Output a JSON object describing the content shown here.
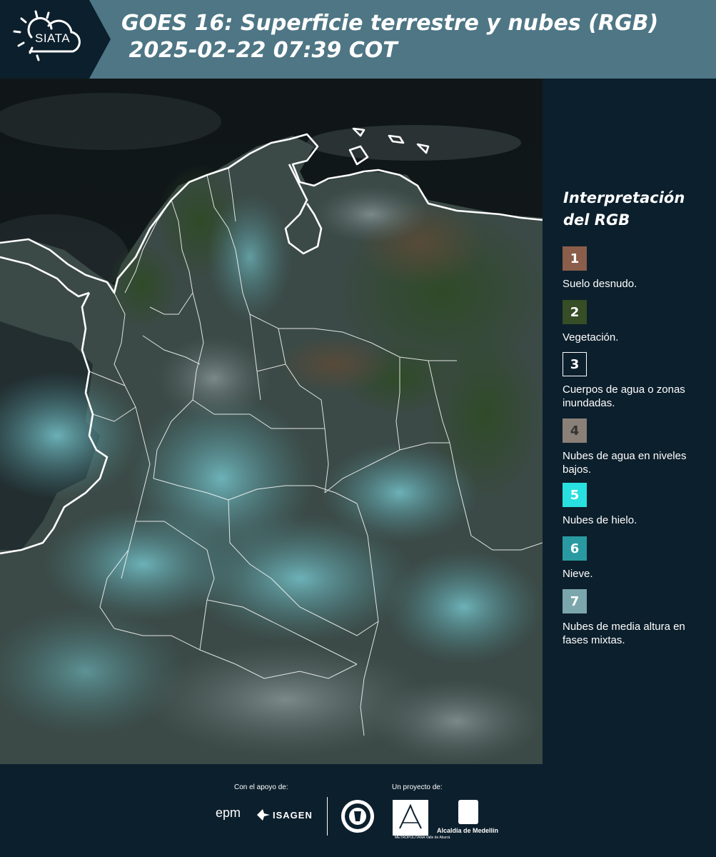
{
  "header": {
    "logo_text": "SIATA",
    "title": "GOES 16: Superficie terrestre y nubes (RGB)\n 2025-02-22 07:39 COT"
  },
  "map": {
    "description_icon": "satellite-rgb-image"
  },
  "legend": {
    "title": "Interpretación del RGB",
    "items": [
      {
        "num": "1",
        "label": "Suelo desnudo.",
        "color": "#8a5e4a",
        "text_color": "#ffffff"
      },
      {
        "num": "2",
        "label": "Vegetación.",
        "color": "#364d25",
        "text_color": "#ffffff"
      },
      {
        "num": "3",
        "label": "Cuerpos de agua o zonas inundadas.",
        "color": "#0c1f2c",
        "text_color": "#ffffff"
      },
      {
        "num": "4",
        "label": "Nubes de agua en niveles bajos.",
        "color": "#8a8078",
        "text_color": "#333333"
      },
      {
        "num": "5",
        "label": "Nubes de hielo.",
        "color": "#29e0e0",
        "text_color": "#ffffff"
      },
      {
        "num": "6",
        "label": "Nieve.",
        "color": "#2a9aa2",
        "text_color": "#ffffff"
      },
      {
        "num": "7",
        "label": "Nubes de media altura en fases mixtas.",
        "color": "#7ba7ac",
        "text_color": "#ffffff"
      }
    ]
  },
  "footer": {
    "support_label": "Con el apoyo de:",
    "project_label": "Un proyecto de:",
    "epm": "epm",
    "isagen": "ISAGEN",
    "area_text": "METROPOLITANA Valle de Aburrá",
    "alcaldia": "Alcaldía de Medellín"
  }
}
